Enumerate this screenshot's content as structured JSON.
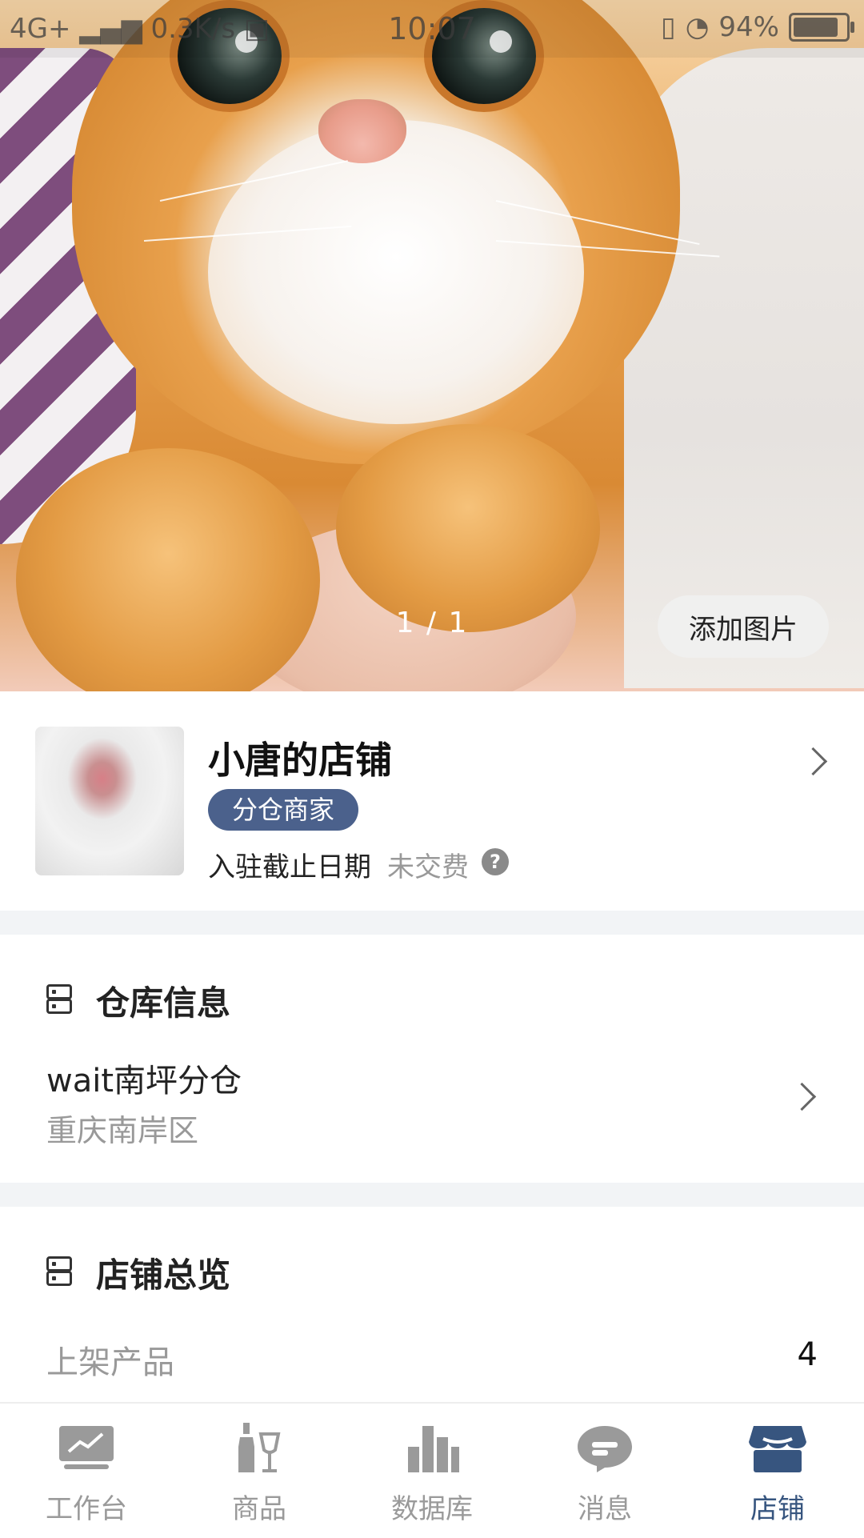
{
  "status_bar": {
    "network": "4G+",
    "speed": "0.3K/s",
    "time": "10:07",
    "battery": "94%",
    "battery_level": 0.94
  },
  "hero": {
    "pager": "1 / 1",
    "add_image_label": "添加图片"
  },
  "shop": {
    "name": "小唐的店铺",
    "badge": "分仓商家",
    "deadline_label": "入驻截止日期",
    "deadline_value": "未交费",
    "help_icon": "?"
  },
  "warehouse": {
    "title": "仓库信息",
    "name": "wait南坪分仓",
    "address": "重庆南岸区"
  },
  "overview": {
    "title": "店铺总览",
    "rows": [
      {
        "label": "上架产品",
        "value": "4"
      }
    ]
  },
  "tabbar": {
    "items": [
      {
        "label": "工作台",
        "icon": "dashboard-chart-icon"
      },
      {
        "label": "商品",
        "icon": "bottle-glass-icon"
      },
      {
        "label": "数据库",
        "icon": "bar-chart-icon"
      },
      {
        "label": "消息",
        "icon": "chat-bubble-icon"
      },
      {
        "label": "店铺",
        "icon": "store-icon"
      }
    ],
    "active_index": 4,
    "colors": {
      "active": "#37557f",
      "inactive": "#9a9a9a"
    }
  }
}
